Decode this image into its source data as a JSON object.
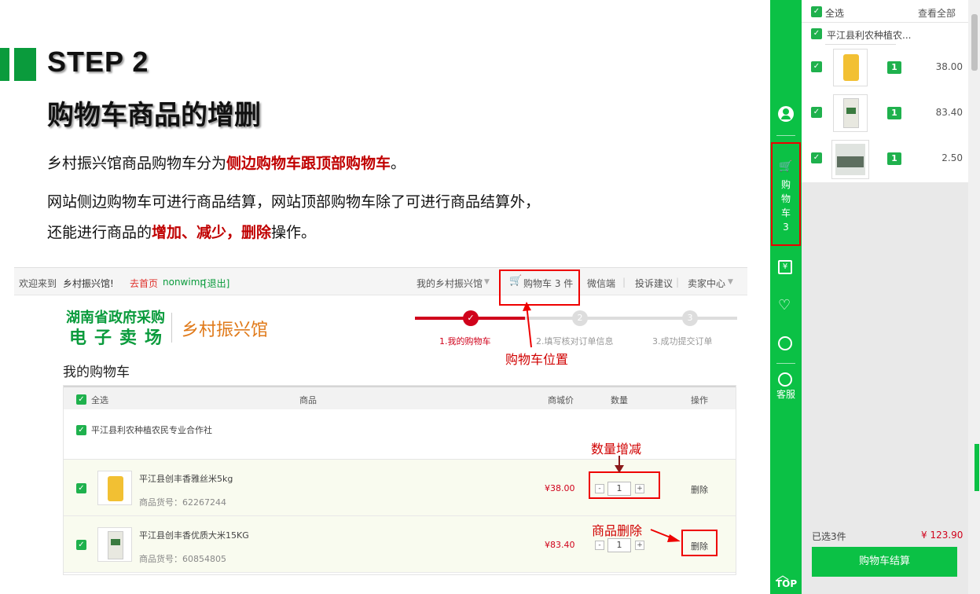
{
  "slide": {
    "step": "STEP 2",
    "title": "购物车商品的增删",
    "p1_a": "乡村振兴馆商品购物车分为",
    "p1_red": "侧边购物车跟顶部购物车",
    "p1_b": "。",
    "p2": "网站侧边购物车可进行商品结算，网站顶部购物车除了可进行商品结算外，",
    "p3_a": "还能进行商品的",
    "p3_red": "增加、减少，删除",
    "p3_b": "操作。"
  },
  "topbar": {
    "welcome": "欢迎来到",
    "site": "乡村振兴馆!",
    "home": "去首页",
    "user": "nonwimp",
    "logout": "[退出]",
    "my_hall": "我的乡村振兴馆",
    "cart": "购物车 3 件",
    "wechat": "微信端",
    "complaint": "投诉建议",
    "seller": "卖家中心"
  },
  "logo": {
    "line1": "湖南省政府采购",
    "line2": "电子卖场",
    "brand": "乡村振兴馆"
  },
  "progress": {
    "steps": [
      "1.我的购物车",
      "2.填写核对订单信息",
      "3.成功提交订单"
    ],
    "dot2": "2",
    "dot3": "3"
  },
  "cart": {
    "heading": "我的购物车",
    "headers": {
      "select_all": "全选",
      "product": "商品",
      "price": "商城价",
      "qty": "数量",
      "action": "操作"
    },
    "shop": "平江县利农种植农民专业合作社",
    "items": [
      {
        "name": "平江县创丰香雅丝米5kg",
        "code": "商品货号：62267244",
        "price": "¥38.00",
        "qty": "1",
        "delete": "删除"
      },
      {
        "name": "平江县创丰香优质大米15KG",
        "code": "商品货号：60854805",
        "price": "¥83.40",
        "qty": "1",
        "delete": "删除"
      }
    ]
  },
  "annotations": {
    "cart_position": "购物车位置",
    "qty_change": "数量增减",
    "delete_item": "商品删除"
  },
  "sidebar": {
    "cart_chars": [
      "购",
      "物",
      "车"
    ],
    "cart_count": "3",
    "service": "客服",
    "top": "TOP",
    "select_all": "全选",
    "view_all": "查看全部",
    "shop": "平江县利农种植农...",
    "items": [
      {
        "qty": "1",
        "price": "38.00"
      },
      {
        "qty": "1",
        "price": "83.40"
      },
      {
        "qty": "1",
        "price": "2.50"
      }
    ],
    "selected": "已选3件",
    "total": "¥ 123.90",
    "checkout": "购物车结算"
  },
  "colors": {
    "brand_green": "#0bc145",
    "highlight_red": "#c00000",
    "price_red": "#d0021b"
  }
}
